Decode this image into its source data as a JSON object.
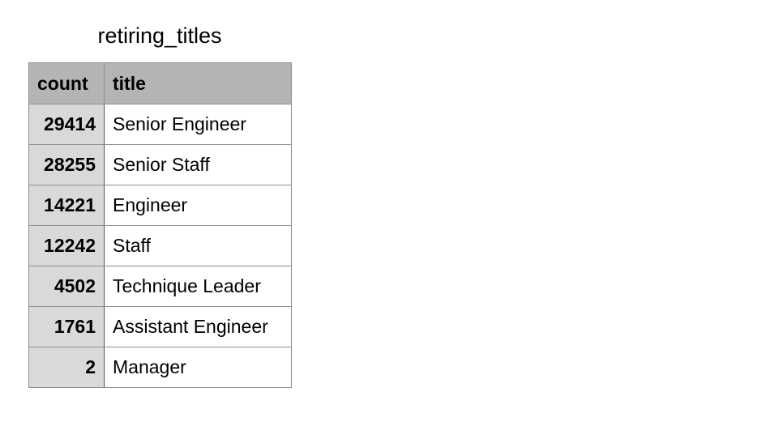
{
  "title": "retiring_titles",
  "columns": {
    "count": "count",
    "title": "title"
  },
  "rows": [
    {
      "count": "29414",
      "title": "Senior Engineer"
    },
    {
      "count": "28255",
      "title": "Senior Staff"
    },
    {
      "count": "14221",
      "title": "Engineer"
    },
    {
      "count": "12242",
      "title": "Staff"
    },
    {
      "count": "4502",
      "title": "Technique Leader"
    },
    {
      "count": "1761",
      "title": "Assistant Engineer"
    },
    {
      "count": "2",
      "title": "Manager"
    }
  ],
  "colors": {
    "header_background": "#b4b4b4",
    "count_column_background": "#d9d9d9",
    "border": "#8e8e8e"
  }
}
